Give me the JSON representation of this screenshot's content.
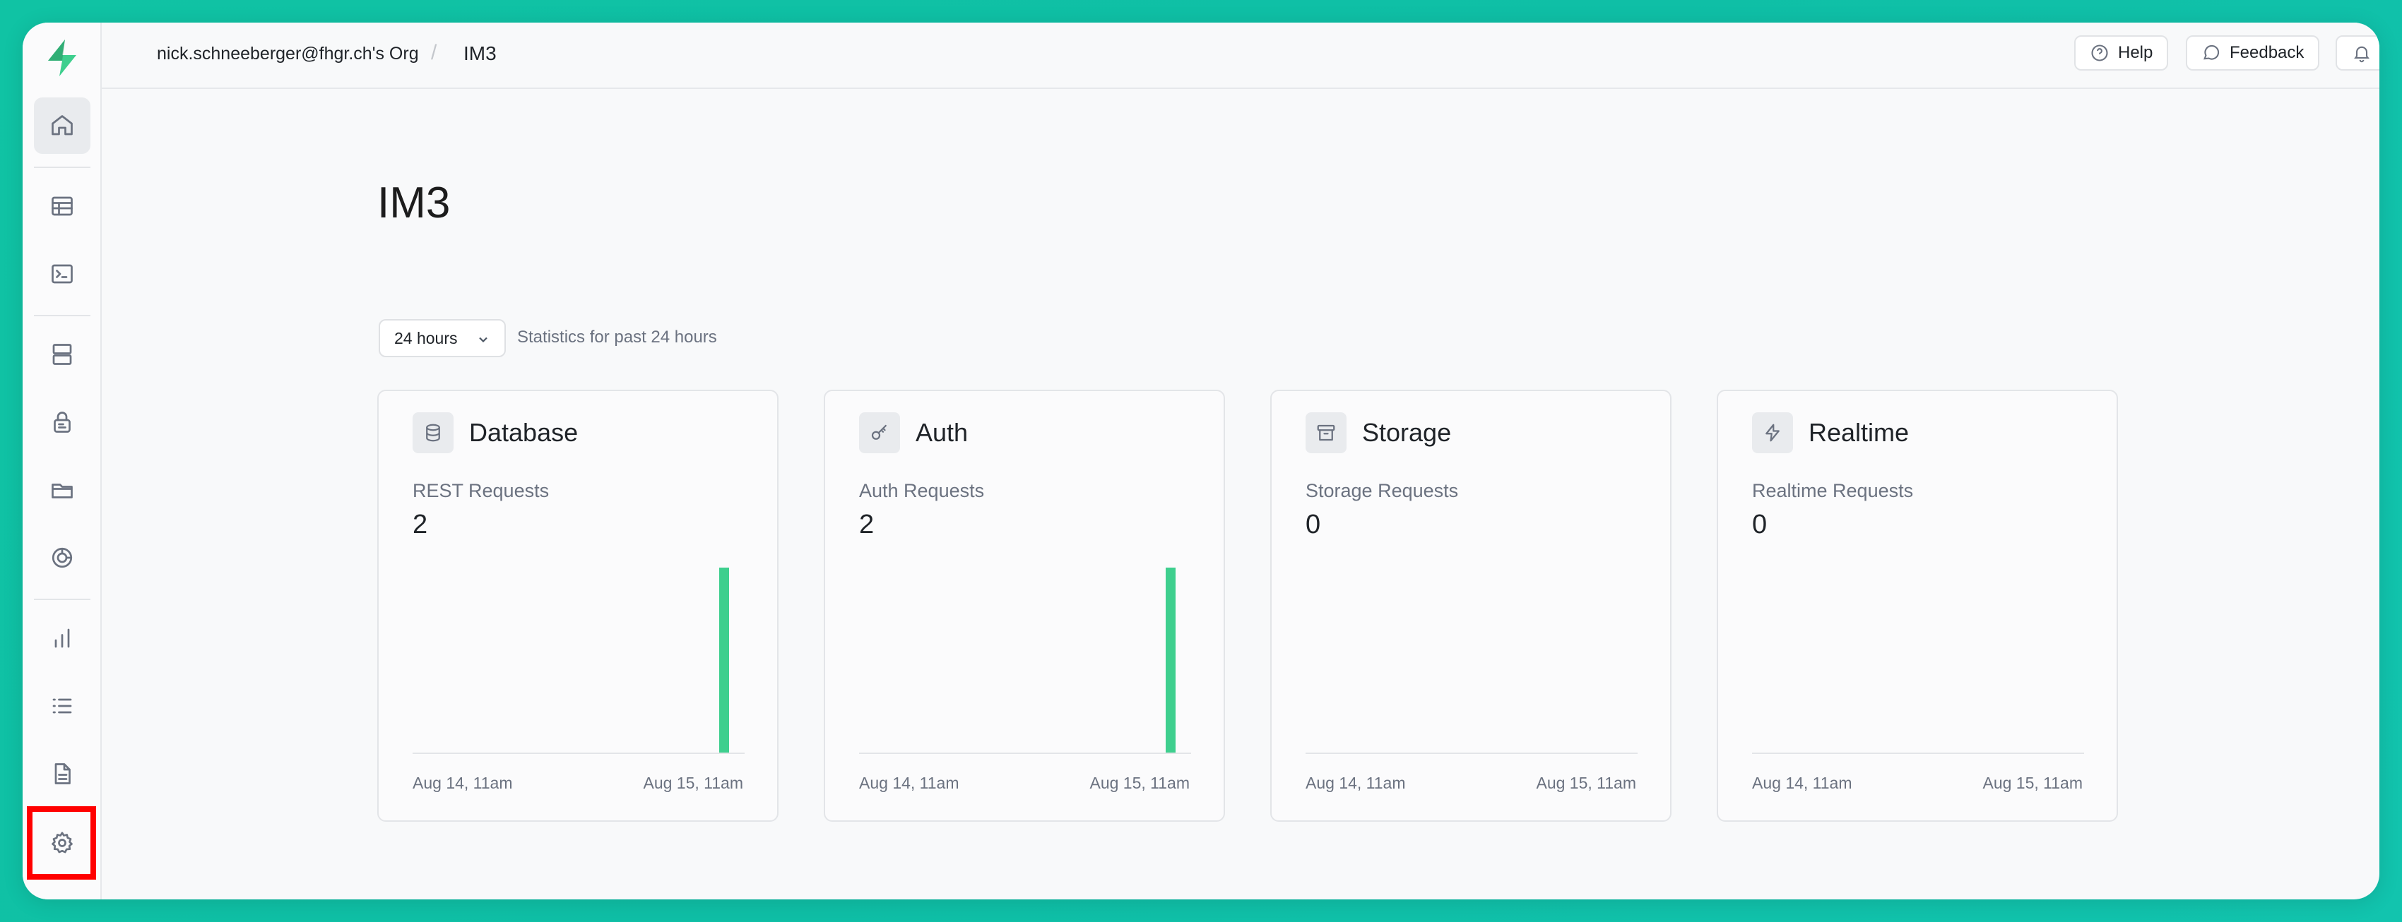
{
  "app": {
    "brand_color": "#3ecf8e"
  },
  "topbar": {
    "org": "nick.schneeberger@fhgr.ch's Org",
    "separator": "/",
    "project": "IM3",
    "help_label": "Help",
    "feedback_label": "Feedback"
  },
  "sidebar": {
    "items": [
      {
        "name": "home",
        "icon": "home-icon",
        "active": true
      },
      {
        "name": "table-editor",
        "icon": "table-icon"
      },
      {
        "name": "sql-editor",
        "icon": "terminal-icon"
      },
      {
        "name": "database",
        "icon": "database-rows-icon"
      },
      {
        "name": "authentication",
        "icon": "auth-icon"
      },
      {
        "name": "storage",
        "icon": "storage-icon"
      },
      {
        "name": "edge-functions",
        "icon": "functions-icon"
      },
      {
        "name": "reports",
        "icon": "bar-chart-icon"
      },
      {
        "name": "logs",
        "icon": "list-icon"
      },
      {
        "name": "api-docs",
        "icon": "document-icon"
      },
      {
        "name": "settings",
        "icon": "gear-icon",
        "highlighted": true
      }
    ]
  },
  "main": {
    "title": "IM3",
    "period_select": "24 hours",
    "period_caption": "Statistics for past 24 hours",
    "cards": [
      {
        "title": "Database",
        "icon": "database-icon",
        "metric": "REST Requests",
        "value": "2",
        "x_start": "Aug 14, 11am",
        "x_end": "Aug 15, 11am"
      },
      {
        "title": "Auth",
        "icon": "key-icon",
        "metric": "Auth Requests",
        "value": "2",
        "x_start": "Aug 14, 11am",
        "x_end": "Aug 15, 11am"
      },
      {
        "title": "Storage",
        "icon": "archive-icon",
        "metric": "Storage Requests",
        "value": "0",
        "x_start": "Aug 14, 11am",
        "x_end": "Aug 15, 11am"
      },
      {
        "title": "Realtime",
        "icon": "lightning-icon",
        "metric": "Realtime Requests",
        "value": "0",
        "x_start": "Aug 14, 11am",
        "x_end": "Aug 15, 11am"
      }
    ]
  },
  "chart_data": [
    {
      "type": "bar",
      "series": [
        {
          "values": [
            0,
            0,
            0,
            0,
            0,
            0,
            0,
            0,
            0,
            0,
            0,
            0,
            0,
            0,
            0,
            0,
            0,
            0,
            0,
            0,
            0,
            0,
            2,
            0
          ]
        }
      ],
      "x_start": "Aug 14, 11am",
      "x_end": "Aug 15, 11am",
      "color": "#3ecf8e"
    },
    {
      "type": "bar",
      "series": [
        {
          "values": [
            0,
            0,
            0,
            0,
            0,
            0,
            0,
            0,
            0,
            0,
            0,
            0,
            0,
            0,
            0,
            0,
            0,
            0,
            0,
            0,
            0,
            0,
            2,
            0
          ]
        }
      ],
      "x_start": "Aug 14, 11am",
      "x_end": "Aug 15, 11am",
      "color": "#3ecf8e"
    },
    {
      "type": "bar",
      "series": [
        {
          "values": [
            0,
            0,
            0,
            0,
            0,
            0,
            0,
            0,
            0,
            0,
            0,
            0,
            0,
            0,
            0,
            0,
            0,
            0,
            0,
            0,
            0,
            0,
            0,
            0
          ]
        }
      ],
      "x_start": "Aug 14, 11am",
      "x_end": "Aug 15, 11am",
      "color": "#3ecf8e"
    },
    {
      "type": "bar",
      "series": [
        {
          "values": [
            0,
            0,
            0,
            0,
            0,
            0,
            0,
            0,
            0,
            0,
            0,
            0,
            0,
            0,
            0,
            0,
            0,
            0,
            0,
            0,
            0,
            0,
            0,
            0
          ]
        }
      ],
      "x_start": "Aug 14, 11am",
      "x_end": "Aug 15, 11am",
      "color": "#3ecf8e"
    }
  ]
}
